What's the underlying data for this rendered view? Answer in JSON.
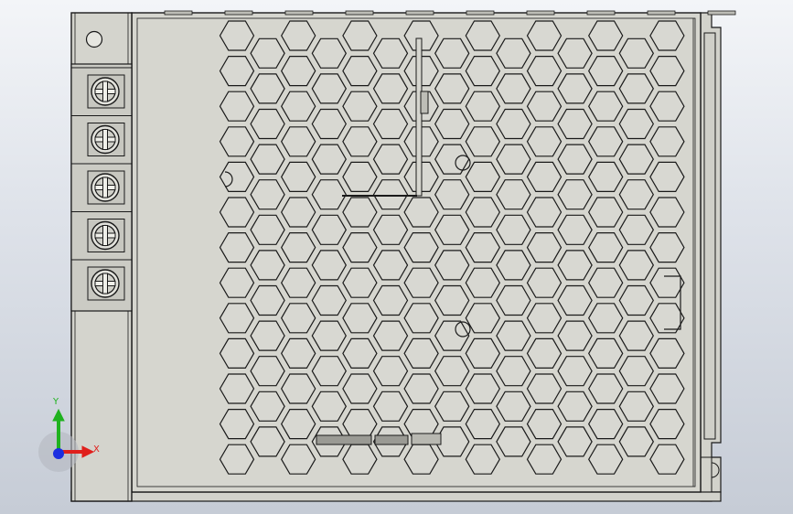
{
  "viewport": {
    "background_top": "#f3f5f8",
    "background_bottom": "#c6ccd6"
  },
  "model": {
    "body_fill": "#d6d6cf",
    "edge_color": "#1a1a1a",
    "terminal_count": 5,
    "hex_rows": 13
  },
  "triad": {
    "x_label": "X",
    "y_label": "Y",
    "x_color": "#e0201c",
    "y_color": "#1fb21f",
    "z_color": "#1c2ee0"
  }
}
